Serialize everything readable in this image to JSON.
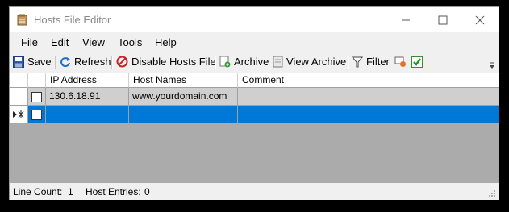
{
  "window": {
    "title": "Hosts File Editor"
  },
  "menu": [
    "File",
    "Edit",
    "View",
    "Tools",
    "Help"
  ],
  "toolbar": {
    "save": "Save",
    "refresh": "Refresh",
    "disable": "Disable Hosts File",
    "archive": "Archive",
    "view_archive": "View Archive",
    "filter": "Filter"
  },
  "grid": {
    "columns": [
      "IP Address",
      "Host Names",
      "Comment"
    ],
    "rows": [
      {
        "checked": false,
        "ip": "130.6.18.91",
        "host": "www.yourdomain.com",
        "comment": "",
        "selected": false
      },
      {
        "checked": false,
        "ip": "",
        "host": "",
        "comment": "",
        "selected": true,
        "new_row": true
      }
    ]
  },
  "status": {
    "line_count_label": "Line Count:",
    "line_count": "1",
    "host_entries_label": "Host Entries:",
    "host_entries": "0"
  },
  "colors": {
    "selection": "#0078d7",
    "row": "#cfcfcf",
    "grid_bg": "#ababab"
  }
}
